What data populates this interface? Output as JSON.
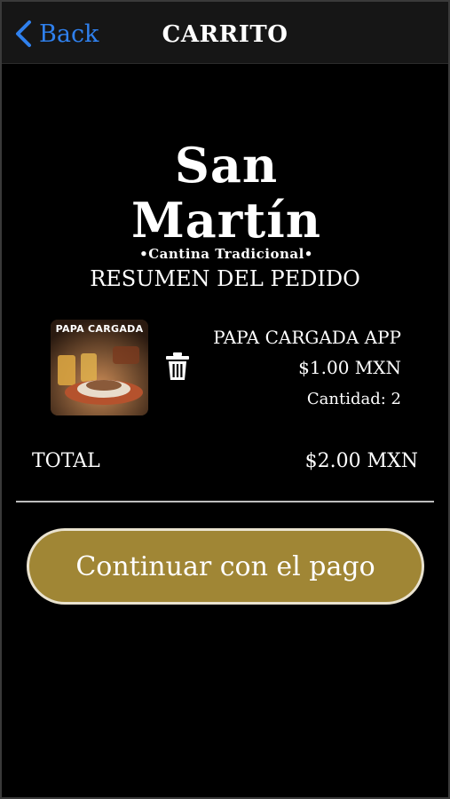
{
  "navbar": {
    "back_label": "Back",
    "title": "CARRITO"
  },
  "brand": {
    "name": "San Martín",
    "tagline": "•Cantina Tradicional•"
  },
  "summary": {
    "title": "RESUMEN DEL PEDIDO"
  },
  "cart_items": [
    {
      "thumbnail_caption": "PAPA CARGADA",
      "name": "PAPA CARGADA APP",
      "price": "$1.00 MXN",
      "quantity": "Cantidad: 2"
    }
  ],
  "totals": {
    "label": "TOTAL",
    "value": "$2.00 MXN"
  },
  "actions": {
    "continue_label": "Continuar con el pago"
  },
  "colors": {
    "background": "#000000",
    "navbar": "#161616",
    "link": "#2f80ed",
    "button": "#a08635"
  }
}
